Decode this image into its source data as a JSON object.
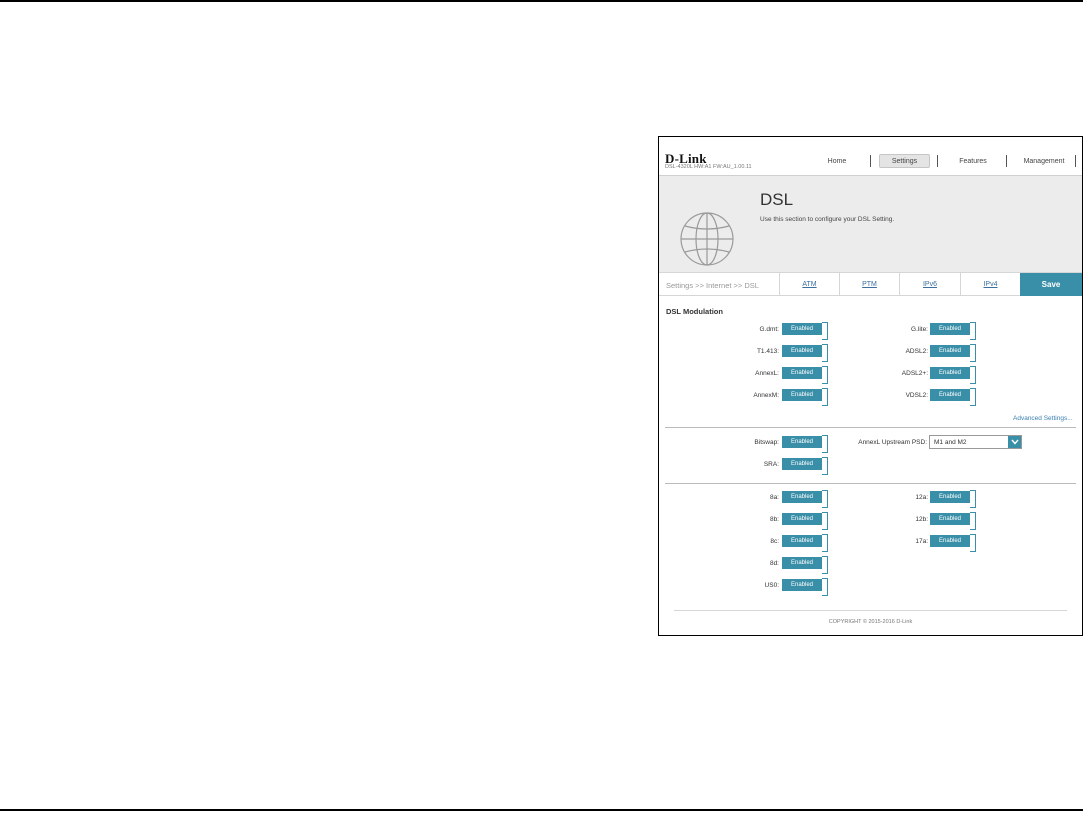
{
  "header": {
    "logo": "D-Link",
    "model_info": "DSL-4320L   HW:A1   FW:AU_1.00.11",
    "nav": [
      "Home",
      "Settings",
      "Features",
      "Management"
    ],
    "active_nav": "Settings"
  },
  "banner": {
    "title": "DSL",
    "subtitle": "Use this section to configure your DSL Setting."
  },
  "tabs": {
    "breadcrumb": "Settings >> Internet >> DSL",
    "items": [
      "ATM",
      "PTM",
      "IPv6",
      "IPv4"
    ],
    "save_label": "Save"
  },
  "modulation": {
    "section_title": "DSL Modulation",
    "left": [
      {
        "label": "G.dmt:",
        "value": "Enabled"
      },
      {
        "label": "T1.413:",
        "value": "Enabled"
      },
      {
        "label": "AnnexL:",
        "value": "Enabled"
      },
      {
        "label": "AnnexM:",
        "value": "Enabled"
      }
    ],
    "right": [
      {
        "label": "G.lite:",
        "value": "Enabled"
      },
      {
        "label": "ADSL2:",
        "value": "Enabled"
      },
      {
        "label": "ADSL2+:",
        "value": "Enabled"
      },
      {
        "label": "VDSL2:",
        "value": "Enabled"
      }
    ],
    "advanced_link": "Advanced Settings..."
  },
  "options": {
    "bitswap": {
      "label": "Bitswap:",
      "value": "Enabled"
    },
    "sra": {
      "label": "SRA:",
      "value": "Enabled"
    },
    "psd_label": "AnnexL Upstream PSD:",
    "psd_value": "M1 and M2"
  },
  "profiles": {
    "left": [
      {
        "label": "8a:",
        "value": "Enabled"
      },
      {
        "label": "8b:",
        "value": "Enabled"
      },
      {
        "label": "8c:",
        "value": "Enabled"
      },
      {
        "label": "8d:",
        "value": "Enabled"
      },
      {
        "label": "US0:",
        "value": "Enabled"
      }
    ],
    "right": [
      {
        "label": "12a:",
        "value": "Enabled"
      },
      {
        "label": "12b:",
        "value": "Enabled"
      },
      {
        "label": "17a:",
        "value": "Enabled"
      }
    ]
  },
  "footer": {
    "copyright": "COPYRIGHT © 2015-2016 D-Link"
  },
  "colors": {
    "accent": "#3a8fa8",
    "link": "#3a6fa0"
  },
  "icons": [
    "globe-icon",
    "chevron-down-icon"
  ]
}
